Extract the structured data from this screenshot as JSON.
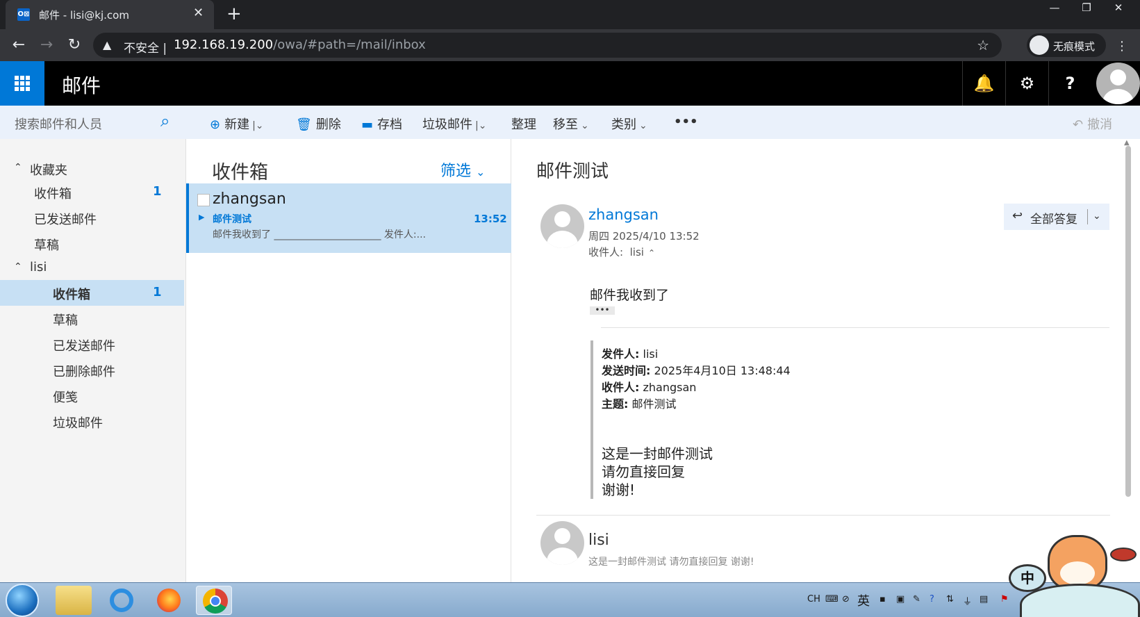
{
  "browser": {
    "tab_title": "邮件 - lisi@kj.com",
    "favicon_text": "O⊠",
    "tab_close": "✕",
    "new_tab": "+",
    "window_minimize": "—",
    "window_restore": "❐",
    "window_close": "✕",
    "back": "←",
    "forward": "→",
    "reload": "↻",
    "insecure_label": "不安全",
    "url_host": "192.168.19.200",
    "url_path": "/owa/#path=/mail/inbox",
    "bookmark_star": "☆",
    "incognito_label": "无痕模式",
    "menu": "⋮"
  },
  "owa_header": {
    "app_title": "邮件",
    "notifications_icon": "🔔",
    "settings_icon": "⚙",
    "help_icon": "?"
  },
  "search": {
    "placeholder": "搜索邮件和人员",
    "icon": "⌕"
  },
  "nav": {
    "favorites_header": "收藏夹",
    "favorites": [
      {
        "label": "收件箱",
        "count": "1"
      },
      {
        "label": "已发送邮件"
      },
      {
        "label": "草稿"
      }
    ],
    "account_header": "lisi",
    "folders": [
      {
        "label": "收件箱",
        "count": "1",
        "selected": true
      },
      {
        "label": "草稿"
      },
      {
        "label": "已发送邮件"
      },
      {
        "label": "已删除邮件"
      },
      {
        "label": "便笺"
      },
      {
        "label": "垃圾邮件"
      }
    ]
  },
  "commands": {
    "new": "新建",
    "delete": "删除",
    "archive": "存档",
    "junk": "垃圾邮件",
    "sweep": "整理",
    "move": "移至",
    "categories": "类别",
    "more": "•••",
    "undo": "撤消"
  },
  "list": {
    "title": "收件箱",
    "filter": "筛选",
    "messages": [
      {
        "from": "zhangsan",
        "subject": "邮件测试",
        "time": "13:52",
        "preview": "邮件我收到了 ______________________ 发件人:..."
      }
    ]
  },
  "reading": {
    "subject": "邮件测试",
    "sender": "zhangsan",
    "date": "周四 2025/4/10 13:52",
    "to_label": "收件人:",
    "to_value": "lisi",
    "reply_all": "全部答复",
    "body": "邮件我收到了",
    "ellipsis": "•••",
    "quoted": {
      "from_label": "发件人:",
      "from_value": "lisi",
      "sent_label": "发送时间:",
      "sent_value": "2025年4月10日 13:48:44",
      "to_label": "收件人:",
      "to_value": "zhangsan",
      "subject_label": "主题:",
      "subject_value": "邮件测试",
      "lines": [
        "这是一封邮件测试",
        "请勿直接回复",
        "谢谢!"
      ]
    },
    "thread_reply": {
      "sender": "lisi",
      "preview": "这是一封邮件测试 请勿直接回复 谢谢!"
    }
  },
  "taskbar": {
    "tray_lang": "CH",
    "tray_ime_char": "英",
    "ime_badge": "中"
  },
  "colors": {
    "accent": "#0078d7",
    "selected_bg": "#c7e0f4",
    "commandbar_bg": "#eaf1fb",
    "header_bg": "#000000"
  }
}
